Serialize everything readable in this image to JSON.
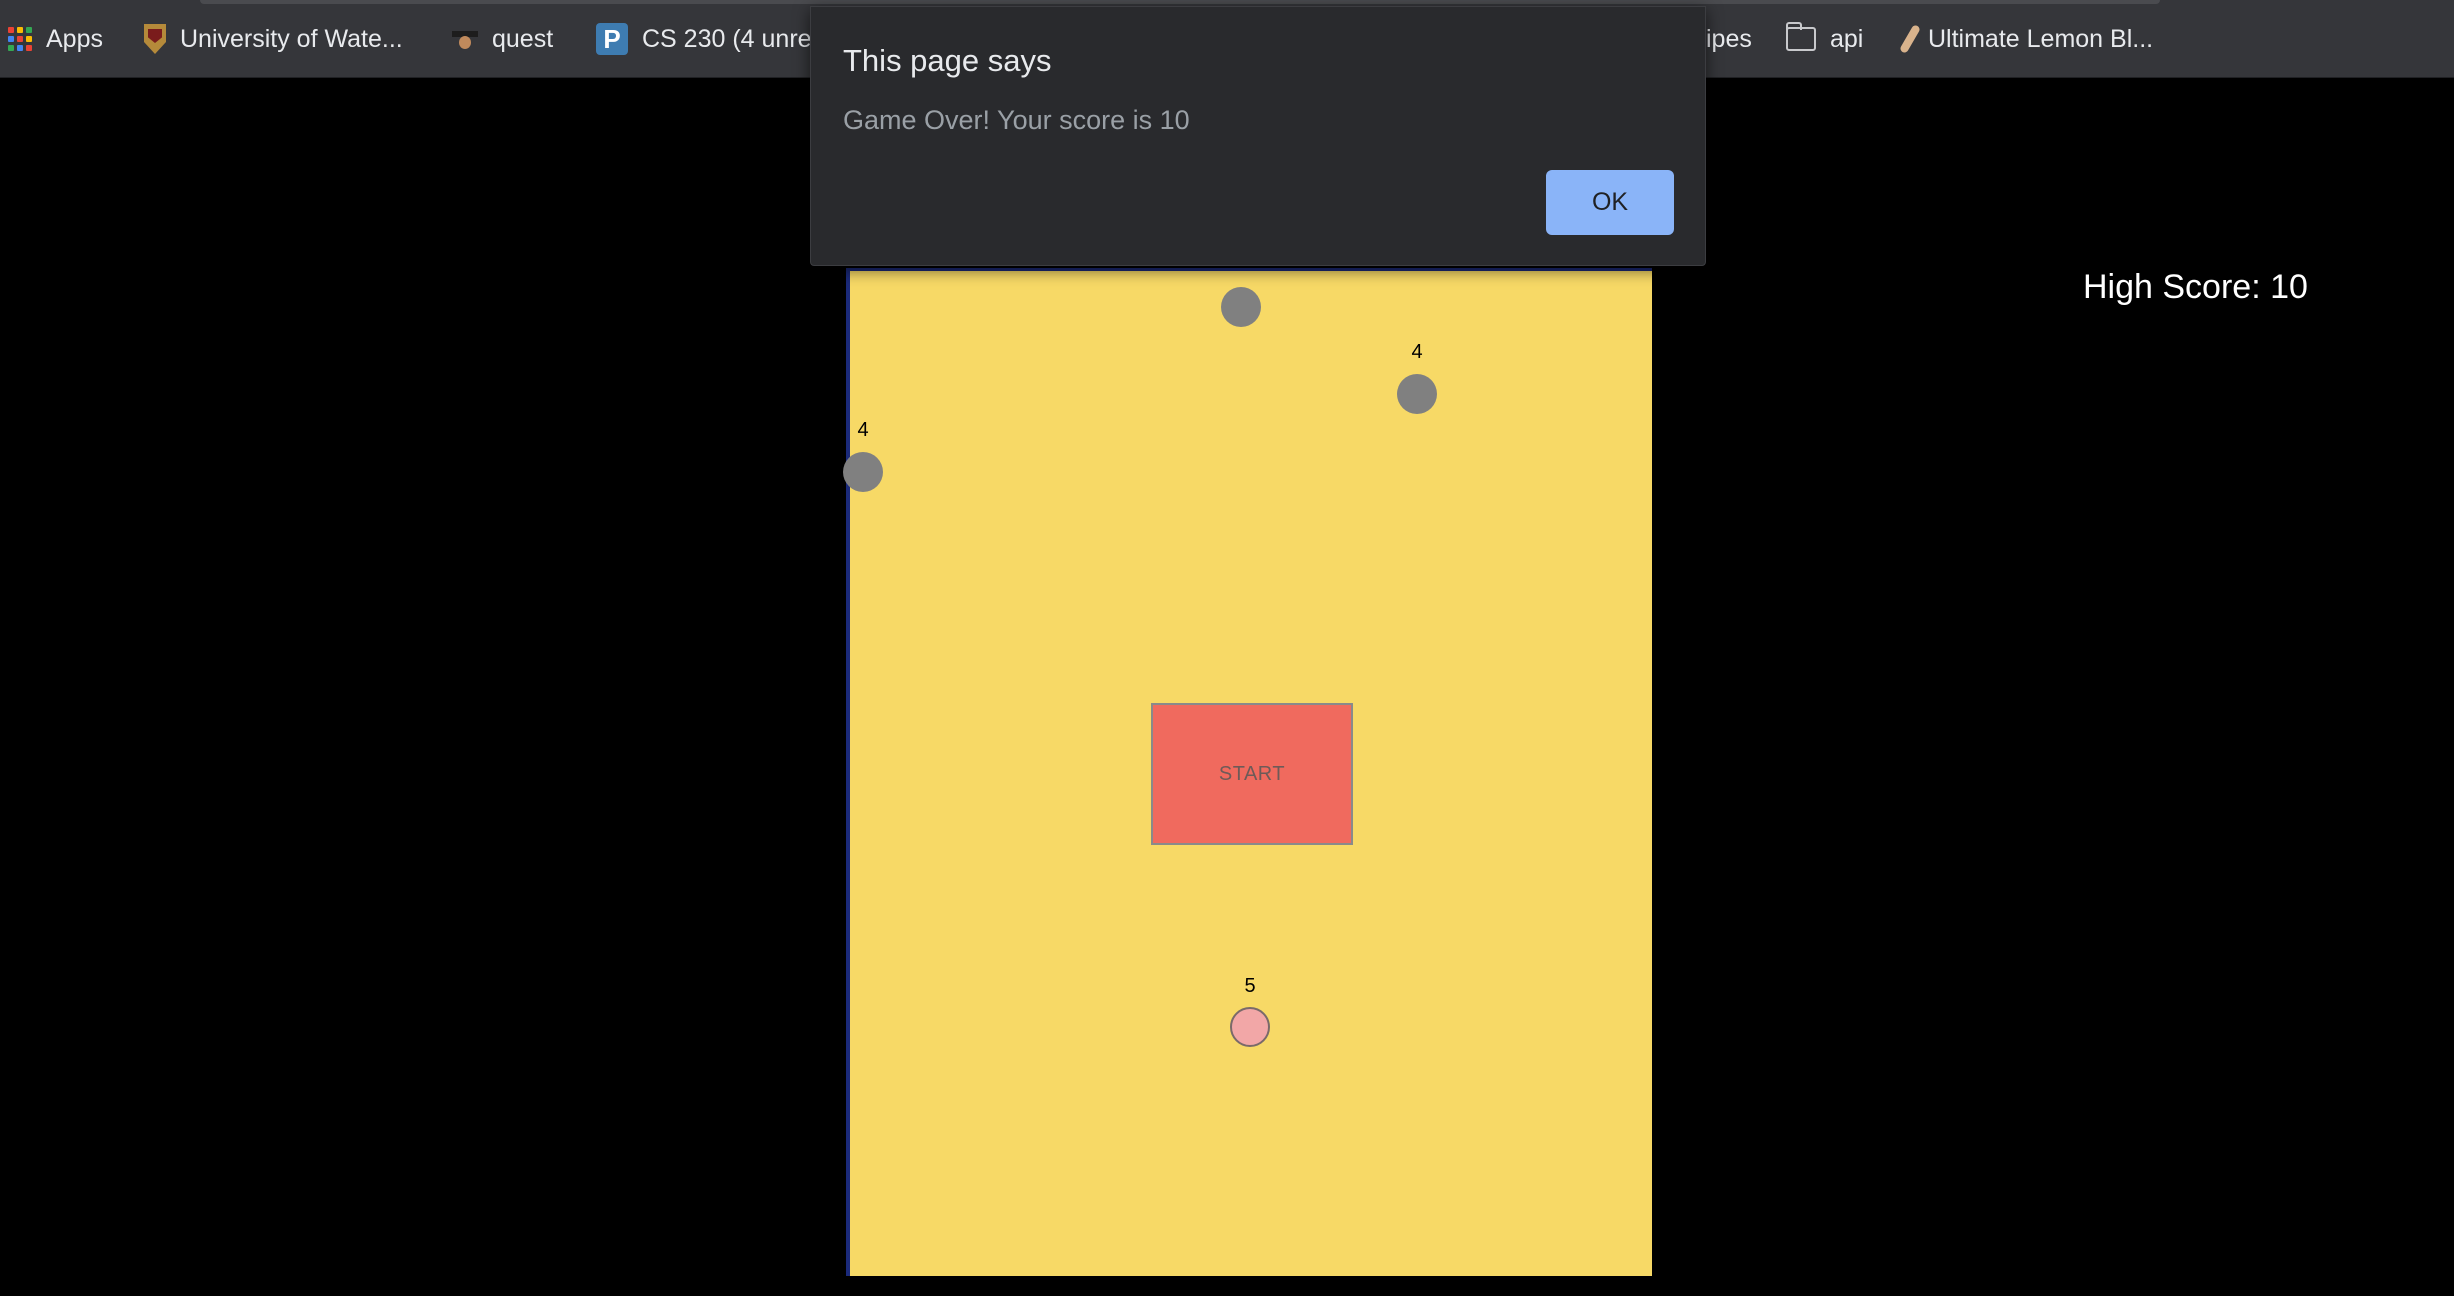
{
  "bookmarks": [
    {
      "label": "Apps",
      "icon": "apps-grid-icon"
    },
    {
      "label": "University of Wate...",
      "icon": "university-shield-icon"
    },
    {
      "label": "quest",
      "icon": "quest-icon"
    },
    {
      "label": "CS 230 (4 unre",
      "icon": "piazza-icon",
      "icon_text": "P"
    },
    {
      "label": "ipes",
      "icon": ""
    },
    {
      "label": "api",
      "icon": "folder-icon"
    },
    {
      "label": "Ultimate Lemon Bl...",
      "icon": "spoon-icon"
    }
  ],
  "alert": {
    "title": "This page says",
    "message": "Game Over! Your score is 10",
    "ok_label": "OK"
  },
  "game": {
    "high_score_text": "High Score: 10",
    "start_label": "START",
    "enemy_ball_labels": [
      "",
      "4",
      "4"
    ],
    "player_ball_label": "5",
    "colors": {
      "canvas": "#f7d966",
      "enemy": "#808080",
      "player": "#f2a7a7",
      "start_button": "#f06a5e",
      "border": "#1b2a7a"
    }
  }
}
